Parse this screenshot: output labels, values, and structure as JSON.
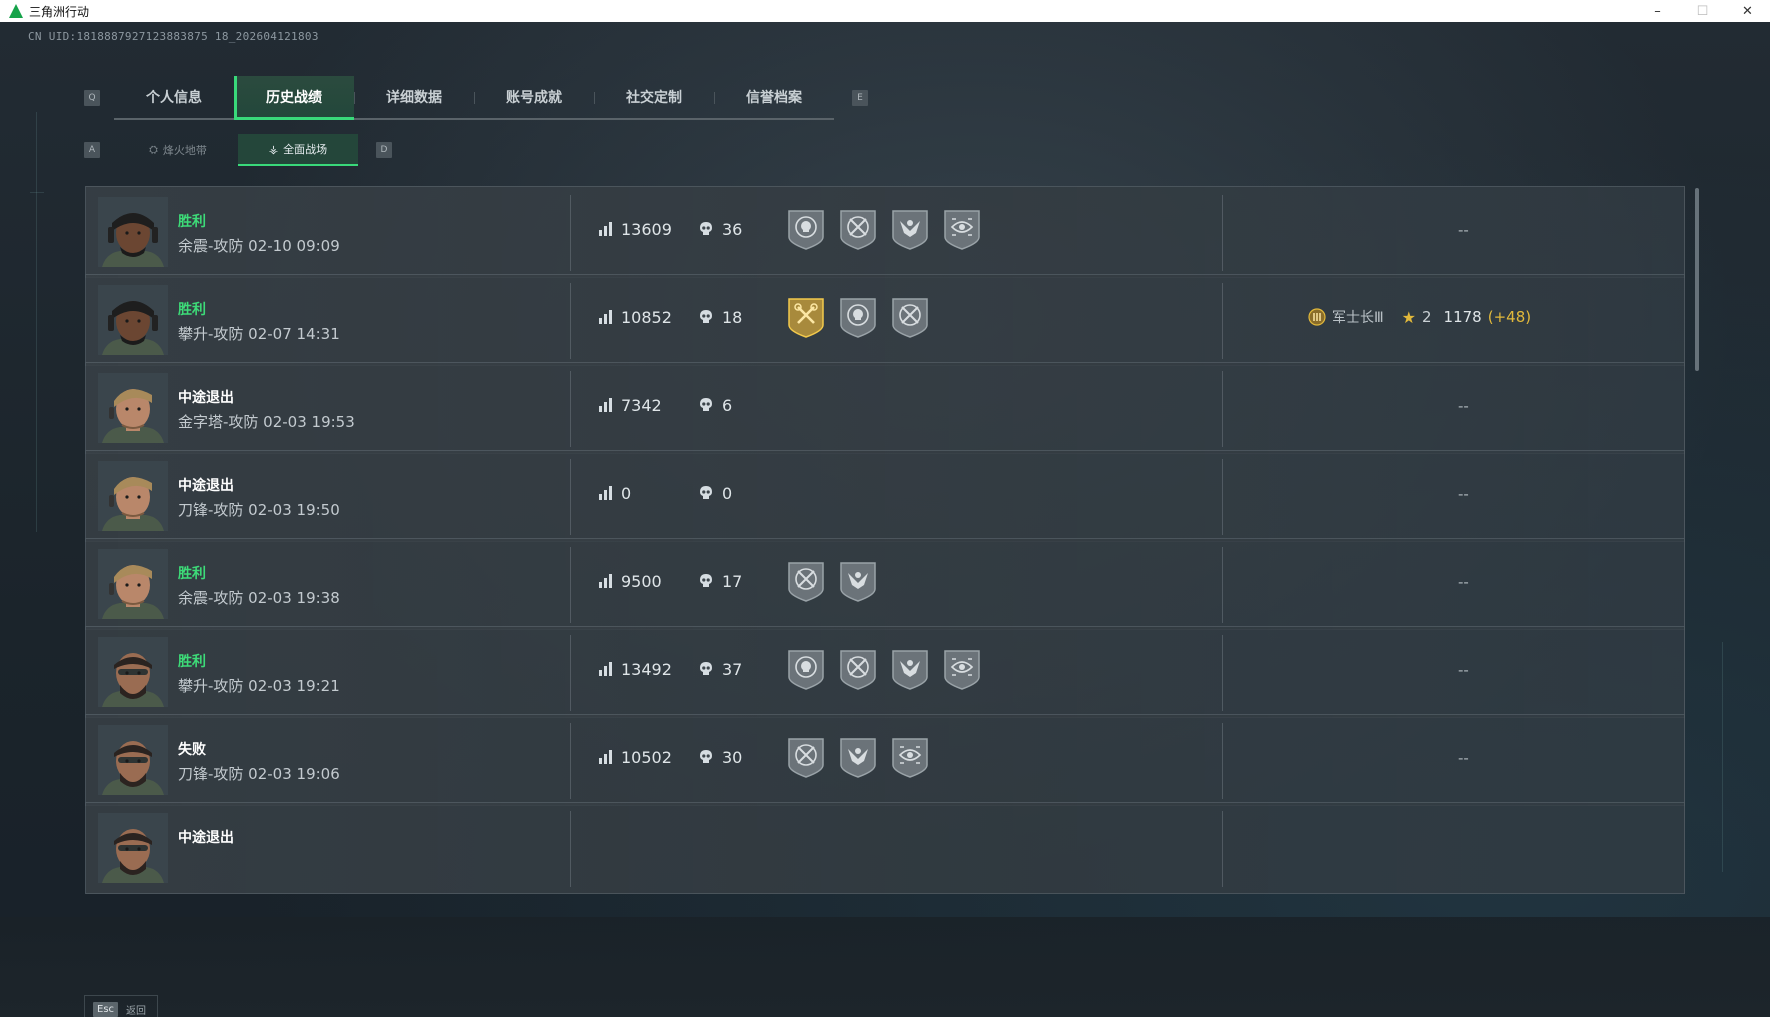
{
  "window": {
    "title": "三角洲行动",
    "minimize": "–",
    "maximize": "☐",
    "close": "✕"
  },
  "uid": "CN UID:1818887927123883875 18_202604121803",
  "tabs": {
    "prev_key": "Q",
    "next_key": "E",
    "items": [
      "个人信息",
      "历史战绩",
      "详细数据",
      "账号成就",
      "社交定制",
      "信誉档案"
    ],
    "active_index": 1
  },
  "subtabs": {
    "prev_key": "A",
    "next_key": "D",
    "items": [
      {
        "label": "烽火地带",
        "icon": "extraction-icon"
      },
      {
        "label": "全面战场",
        "icon": "warfare-icon"
      }
    ],
    "active_index": 1
  },
  "matches": [
    {
      "result": "胜利",
      "result_type": "win",
      "map": "余震-攻防 02-10 09:09",
      "score": "13609",
      "kills": "36",
      "badges": [
        "skull-target-badge",
        "crossed-rifle-badge",
        "eagle-badge",
        "eye-scope-badge"
      ],
      "rank": null,
      "right": "--",
      "avatar": "dark"
    },
    {
      "result": "胜利",
      "result_type": "win",
      "map": "攀升-攻防 02-07 14:31",
      "score": "10852",
      "kills": "18",
      "badges": [
        "gold-wrench-badge",
        "skull-target-badge",
        "crossed-rifle-badge"
      ],
      "rank": {
        "name": "军士长Ⅲ",
        "stars": "2",
        "points": "1178",
        "gain": "(+48)"
      },
      "right": "",
      "avatar": "dark"
    },
    {
      "result": "中途退出",
      "result_type": "quit",
      "map": "金字塔-攻防 02-03 19:53",
      "score": "7342",
      "kills": "6",
      "badges": [],
      "rank": null,
      "right": "--",
      "avatar": "blond"
    },
    {
      "result": "中途退出",
      "result_type": "quit",
      "map": "刀锋-攻防 02-03 19:50",
      "score": "0",
      "kills": "0",
      "badges": [],
      "rank": null,
      "right": "--",
      "avatar": "blond"
    },
    {
      "result": "胜利",
      "result_type": "win",
      "map": "余震-攻防 02-03 19:38",
      "score": "9500",
      "kills": "17",
      "badges": [
        "crossed-rifle-badge",
        "eagle-badge"
      ],
      "rank": null,
      "right": "--",
      "avatar": "blond"
    },
    {
      "result": "胜利",
      "result_type": "win",
      "map": "攀升-攻防 02-03 19:21",
      "score": "13492",
      "kills": "37",
      "badges": [
        "skull-target-badge",
        "crossed-rifle-badge",
        "eagle-badge",
        "eye-scope-badge"
      ],
      "rank": null,
      "right": "--",
      "avatar": "bearded"
    },
    {
      "result": "失败",
      "result_type": "loss",
      "map": "刀锋-攻防 02-03 19:06",
      "score": "10502",
      "kills": "30",
      "badges": [
        "crossed-rifle-badge",
        "eagle-badge",
        "eye-scope-badge"
      ],
      "rank": null,
      "right": "--",
      "avatar": "bearded"
    },
    {
      "result": "中途退出",
      "result_type": "quit",
      "map": "",
      "score": "",
      "kills": "",
      "badges": [],
      "rank": null,
      "right": "",
      "avatar": "bearded"
    }
  ],
  "footer": {
    "esc_key": "Esc",
    "back_label": "返回"
  },
  "colors": {
    "accent_green": "#39d97a",
    "win_text": "#3ddb78",
    "gain_gold": "#e2b93b",
    "row_bg": "#384046"
  }
}
